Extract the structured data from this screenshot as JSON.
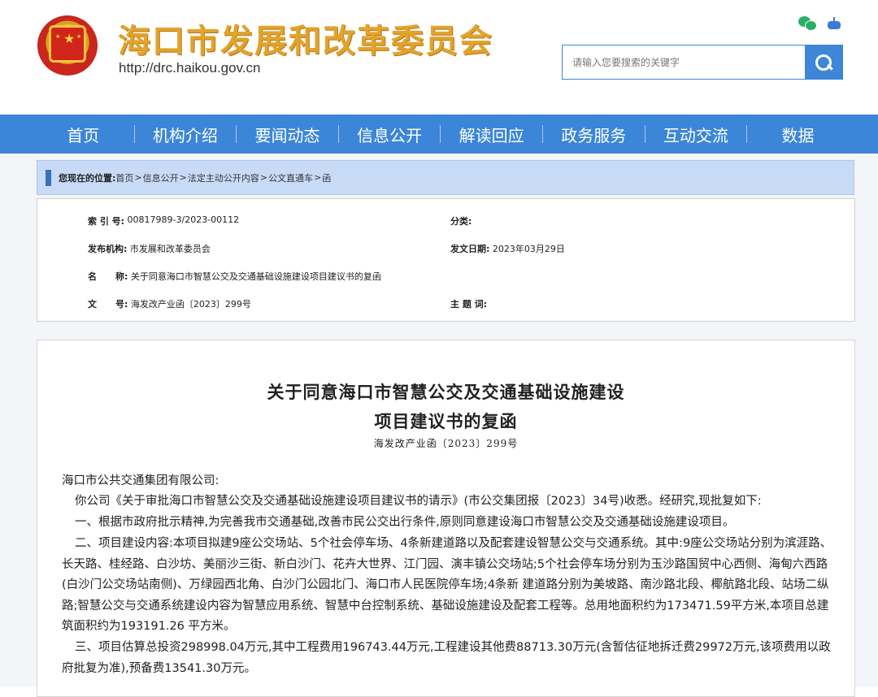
{
  "header": {
    "site_title": "海口市发展和改革委员会",
    "site_url": "http://drc.haikou.gov.cn",
    "search_placeholder": "请输入您要搜索的关键字"
  },
  "nav": {
    "items": [
      "首页",
      "机构介绍",
      "要闻动态",
      "信息公开",
      "解读回应",
      "政务服务",
      "互动交流",
      "数据"
    ]
  },
  "breadcrumb": {
    "label": "您现在的位置:",
    "items": [
      "首页",
      "信息公开",
      "法定主动公开内容",
      "公文直通车",
      "函"
    ],
    "sep": ">"
  },
  "meta": {
    "index_label": "索 引 号:",
    "index_value": " 00817989-3/2023-00112",
    "category_label": "分类:",
    "category_value": "",
    "publisher_label": "发布机构:",
    "publisher_value": " 市发展和改革委员会",
    "date_label": "发文日期:",
    "date_value": " 2023年03月29日",
    "name_label": "名      称:",
    "name_value": " 关于同意海口市智慧公交及交通基础设施建设项目建议书的复函",
    "docno_label": "文      号:",
    "docno_value": " 海发改产业函〔2023〕299号",
    "keywords_label": "主 题 词:",
    "keywords_value": ""
  },
  "article": {
    "title_line1": "关于同意海口市智慧公交及交通基础设施建设",
    "title_line2": "项目建议书的复函",
    "doc_number": "海发改产业函〔2023〕299号",
    "addressee": "海口市公共交通集团有限公司:",
    "para1": "你公司《关于审批海口市智慧公交及交通基础设施建设项目建议书的请示》(市公交集团报〔2023〕34号)收悉。经研究,现批复如下:",
    "para2": "一、根据市政府批示精神,为完善我市交通基础,改善市民公交出行条件,原则同意建设海口市智慧公交及交通基础设施建设项目。",
    "para3": "二、项目建设内容:本项目拟建9座公交场站、5个社会停车场、4条新建道路以及配套建设智慧公交与交通系统。其中:9座公交场站分别为滨涯路、长天路、桂经路、白沙坊、美丽沙三街、新白沙门、花卉大世界、江门园、演丰镇公交场站;5个社会停车场分别为玉沙路国贸中心西侧、海甸六西路(白沙门公交场站南侧)、万绿园西北角、白沙门公园北门、海口市人民医院停车场;4条新 建道路分别为美坡路、南沙路北段、椰航路北段、站场二纵路;智慧公交与交通系统建设内容为智慧应用系统、智慧中台控制系统、基础设施建设及配套工程等。总用地面积约为173471.59平方米,本项目总建筑面积约为193191.26 平方米。",
    "para4": "三、项目估算总投资298998.04万元,其中工程费用196743.44万元,工程建设其他费88713.30万元(含暂估征地拆迁费29972万元,该项费用以政府批复为准),预备费13541.30万元。"
  }
}
